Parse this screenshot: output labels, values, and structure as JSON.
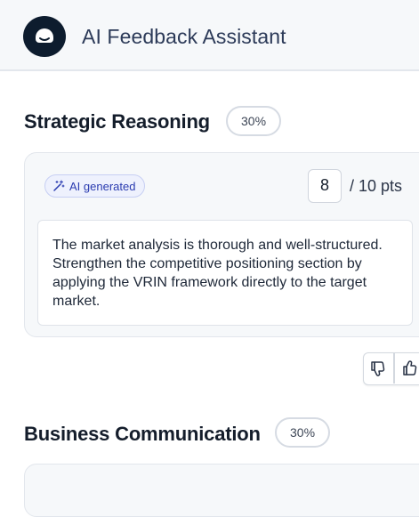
{
  "header": {
    "app_title": "AI Feedback Assistant",
    "logo_icon": "smile-chat-icon"
  },
  "sections": [
    {
      "title": "Strategic Reasoning",
      "weight": "30%",
      "ai_badge": "AI generated",
      "score_value": "8",
      "score_suffix": "/ 10 pts",
      "feedback": "The market analysis is thorough and well-structured. Strengthen the competitive positioning section by applying the VRIN framework directly to the target market."
    },
    {
      "title": "Business Communication",
      "weight": "30%"
    }
  ],
  "feedback_actions": {
    "thumbs_down_icon": "thumbs-down-icon",
    "thumbs_up_icon": "thumbs-up-icon"
  },
  "colors": {
    "header_bg": "#f6f8fa",
    "logo_bg": "#0d1c2e",
    "ai_badge_text": "#2a3bb0",
    "ai_badge_bg": "#eef1fd"
  }
}
